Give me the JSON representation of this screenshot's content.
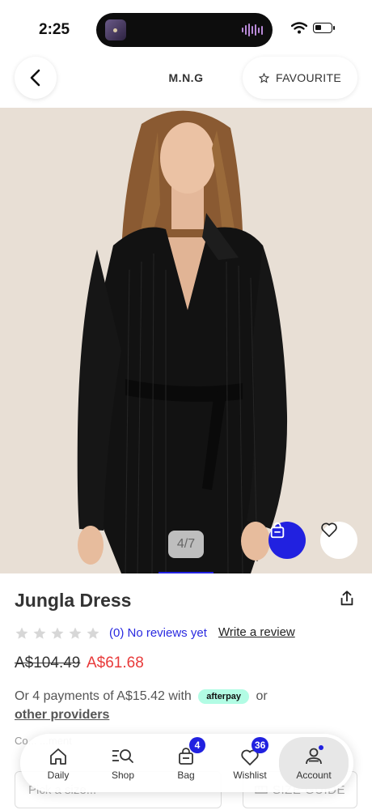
{
  "status": {
    "time": "2:25"
  },
  "header": {
    "brand": "M.N.G",
    "favourite_label": "FAVOURITE"
  },
  "gallery": {
    "counter": "4/7"
  },
  "product": {
    "title": "Jungla Dress",
    "rating": 0,
    "reviews_text": "(0) No reviews yet",
    "write_review": "Write a review",
    "old_price": "A$104.49",
    "new_price": "A$61.68",
    "payment_prefix": "Or 4 payments of A$15.42 with",
    "afterpay": "afterpay",
    "payment_suffix": "or",
    "other_providers": "other providers",
    "color_label": "Co... ...ment",
    "size_placeholder": "Pick a size...",
    "size_guide": "SIZE GUIDE"
  },
  "tabbar": {
    "daily": "Daily",
    "shop": "Shop",
    "bag": "Bag",
    "bag_count": "4",
    "wishlist": "Wishlist",
    "wishlist_count": "36",
    "account": "Account"
  },
  "colors": {
    "accent": "#2121e0",
    "sale": "#e83a3a",
    "afterpay": "#b2fce4"
  }
}
